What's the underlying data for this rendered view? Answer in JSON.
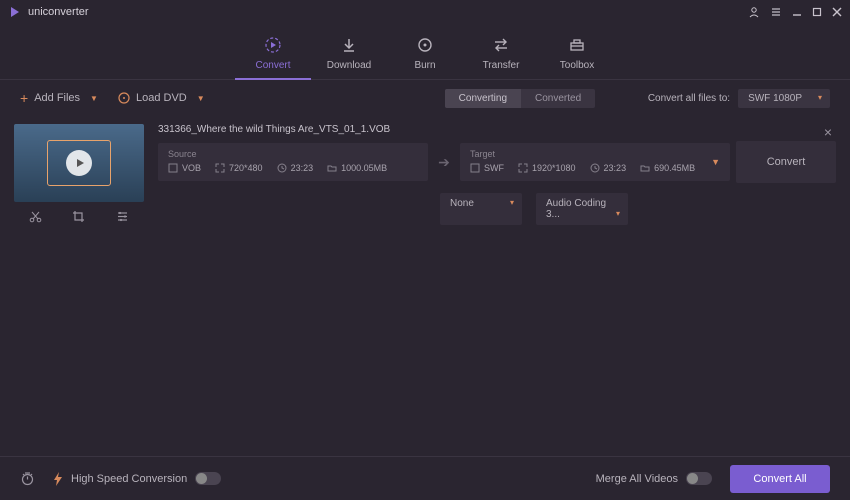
{
  "app": {
    "title": "uniconverter"
  },
  "nav": {
    "convert": "Convert",
    "download": "Download",
    "burn": "Burn",
    "transfer": "Transfer",
    "toolbox": "Toolbox"
  },
  "toolbar": {
    "add_files": "Add Files",
    "load_dvd": "Load DVD",
    "seg_converting": "Converting",
    "seg_converted": "Converted",
    "convert_all_label": "Convert all files to:",
    "target_format": "SWF 1080P"
  },
  "file": {
    "name": "331366_Where the wild Things Are_VTS_01_1.VOB",
    "source": {
      "label": "Source",
      "format": "VOB",
      "resolution": "720*480",
      "duration": "23:23",
      "size": "1000.05MB"
    },
    "target": {
      "label": "Target",
      "format": "SWF",
      "resolution": "1920*1080",
      "duration": "23:23",
      "size": "690.45MB"
    },
    "convert_btn": "Convert",
    "dd_video": "None",
    "dd_audio": "Audio Coding 3..."
  },
  "footer": {
    "high_speed": "High Speed Conversion",
    "merge_all": "Merge All Videos",
    "convert_all": "Convert All"
  },
  "colors": {
    "accent": "#8b6fd6",
    "orange": "#d88a5c",
    "bg": "#2a2530",
    "panel": "#342e3b"
  }
}
